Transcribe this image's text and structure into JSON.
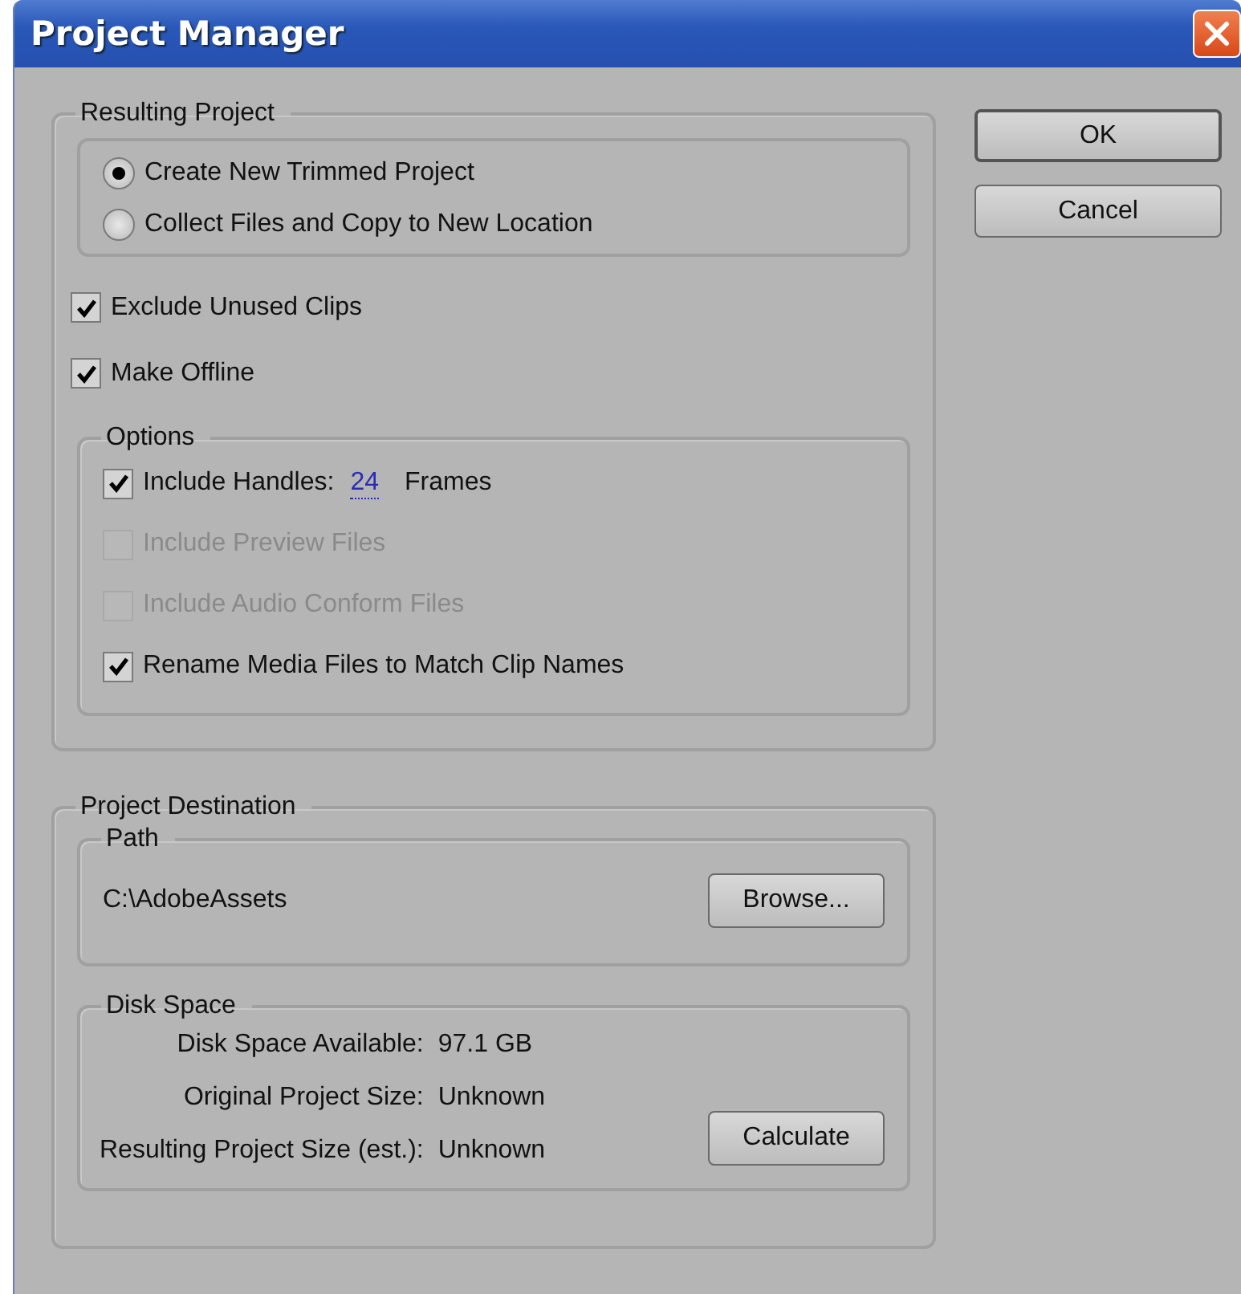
{
  "window": {
    "title": "Project Manager"
  },
  "resulting_project": {
    "title": "Resulting Project",
    "choices": [
      {
        "label": "Create New Trimmed Project",
        "selected": true
      },
      {
        "label": "Collect Files and Copy to New Location",
        "selected": false
      }
    ]
  },
  "toggles": [
    {
      "label": "Exclude Unused Clips",
      "checked": true
    },
    {
      "label": "Make Offline",
      "checked": true
    }
  ],
  "options": {
    "title": "Options",
    "items": [
      {
        "label": "Include Handles:",
        "checked": true,
        "disabled": false,
        "value": "24",
        "suffix": "Frames"
      },
      {
        "label": "Include Preview Files",
        "checked": false,
        "disabled": true
      },
      {
        "label": "Include Audio Conform Files",
        "checked": false,
        "disabled": true
      },
      {
        "label": "Rename Media Files to Match Clip Names",
        "checked": true,
        "disabled": false
      }
    ]
  },
  "destination": {
    "title": "Project Destination",
    "path": {
      "title": "Path",
      "value": "C:\\AdobeAssets",
      "button": "Browse..."
    },
    "disk_space": {
      "title": "Disk Space",
      "rows": [
        {
          "label": "Disk Space Available:",
          "value": "97.1 GB"
        },
        {
          "label": "Original Project Size:",
          "value": "Unknown"
        },
        {
          "label": "Resulting Project Size (est.):",
          "value": "Unknown"
        }
      ],
      "button": "Calculate"
    }
  },
  "buttons": [
    {
      "label": "OK",
      "default": true
    },
    {
      "label": "Cancel",
      "default": false
    }
  ]
}
